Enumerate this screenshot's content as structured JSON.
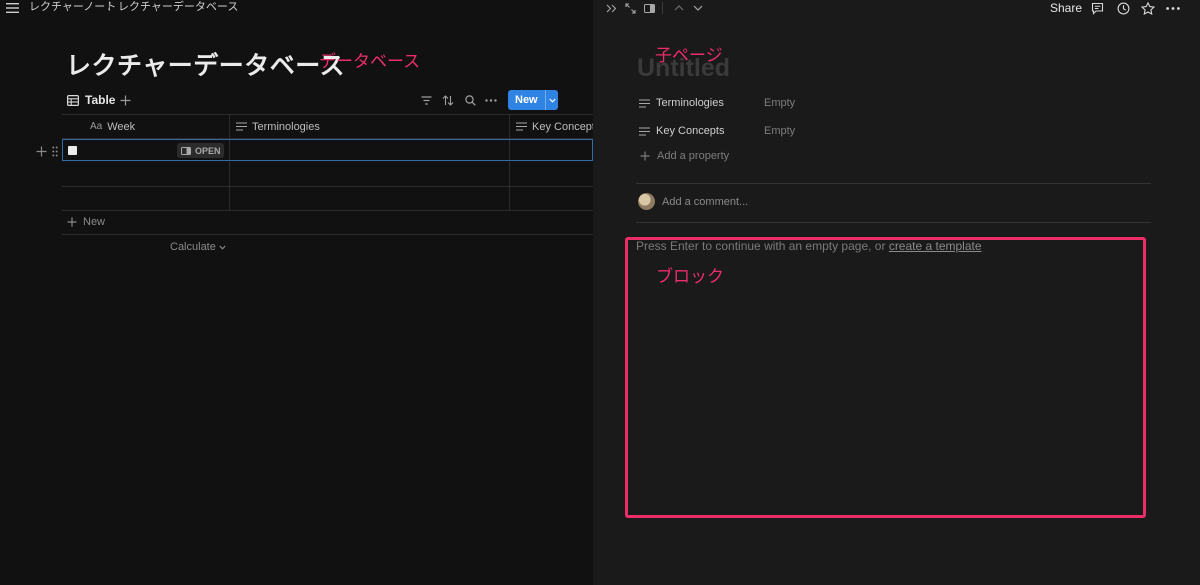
{
  "breadcrumb": {
    "items": [
      "レクチャーノート",
      "レクチャーデータベース"
    ],
    "separator": "/"
  },
  "database": {
    "title": "レクチャーデータベース",
    "view_tab": "Table",
    "new_button": "New",
    "columns": [
      {
        "icon": "Aa",
        "label": "Week"
      },
      {
        "icon": "text-lines-icon",
        "label": "Terminologies"
      },
      {
        "icon": "text-lines-icon",
        "label": "Key Concepts"
      }
    ],
    "open_label": "OPEN",
    "add_new_label": "New",
    "calculate_label": "Calculate"
  },
  "annotations": {
    "database": "データベース",
    "child_page": "子ページ",
    "block": "ブロック"
  },
  "peek": {
    "title_placeholder": "Untitled",
    "properties": [
      {
        "name": "Terminologies",
        "value": "Empty"
      },
      {
        "name": "Key Concepts",
        "value": "Empty"
      }
    ],
    "add_property_label": "Add a property",
    "comment_placeholder": "Add a comment...",
    "hint_text": "Press Enter to continue with an empty page, or ",
    "hint_link": "create a template"
  },
  "topbar": {
    "share_label": "Share"
  },
  "colors": {
    "accent": "#2f83e3",
    "annotation": "#ec2d6a",
    "background": "#111111",
    "peek_background": "#1a1a1a"
  }
}
